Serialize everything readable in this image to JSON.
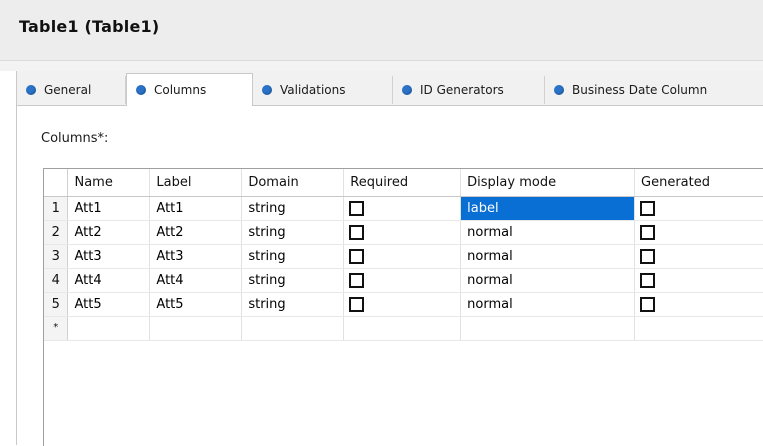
{
  "header": {
    "title": "Table1 (Table1)"
  },
  "tabs": [
    {
      "label": "General",
      "active": false
    },
    {
      "label": "Columns",
      "active": true
    },
    {
      "label": "Validations",
      "active": false
    },
    {
      "label": "ID Generators",
      "active": false
    },
    {
      "label": "Business Date Column",
      "active": false
    }
  ],
  "columns_label": "Columns*:",
  "grid": {
    "headers": [
      "Name",
      "Label",
      "Domain",
      "Required",
      "Display mode",
      "Generated"
    ],
    "rows": [
      {
        "num": "1",
        "name": "Att1",
        "label": "Att1",
        "domain": "string",
        "required": false,
        "display_mode": "label",
        "generated": false
      },
      {
        "num": "2",
        "name": "Att2",
        "label": "Att2",
        "domain": "string",
        "required": false,
        "display_mode": "normal",
        "generated": false
      },
      {
        "num": "3",
        "name": "Att3",
        "label": "Att3",
        "domain": "string",
        "required": false,
        "display_mode": "normal",
        "generated": false
      },
      {
        "num": "4",
        "name": "Att4",
        "label": "Att4",
        "domain": "string",
        "required": false,
        "display_mode": "normal",
        "generated": false
      },
      {
        "num": "5",
        "name": "Att5",
        "label": "Att5",
        "domain": "string",
        "required": false,
        "display_mode": "normal",
        "generated": false
      }
    ],
    "new_row_marker": "*",
    "selected_cell": "row 1, Display mode"
  },
  "colors": {
    "accent": "#0a6fd4",
    "tab_dot": "#2a73c8"
  }
}
